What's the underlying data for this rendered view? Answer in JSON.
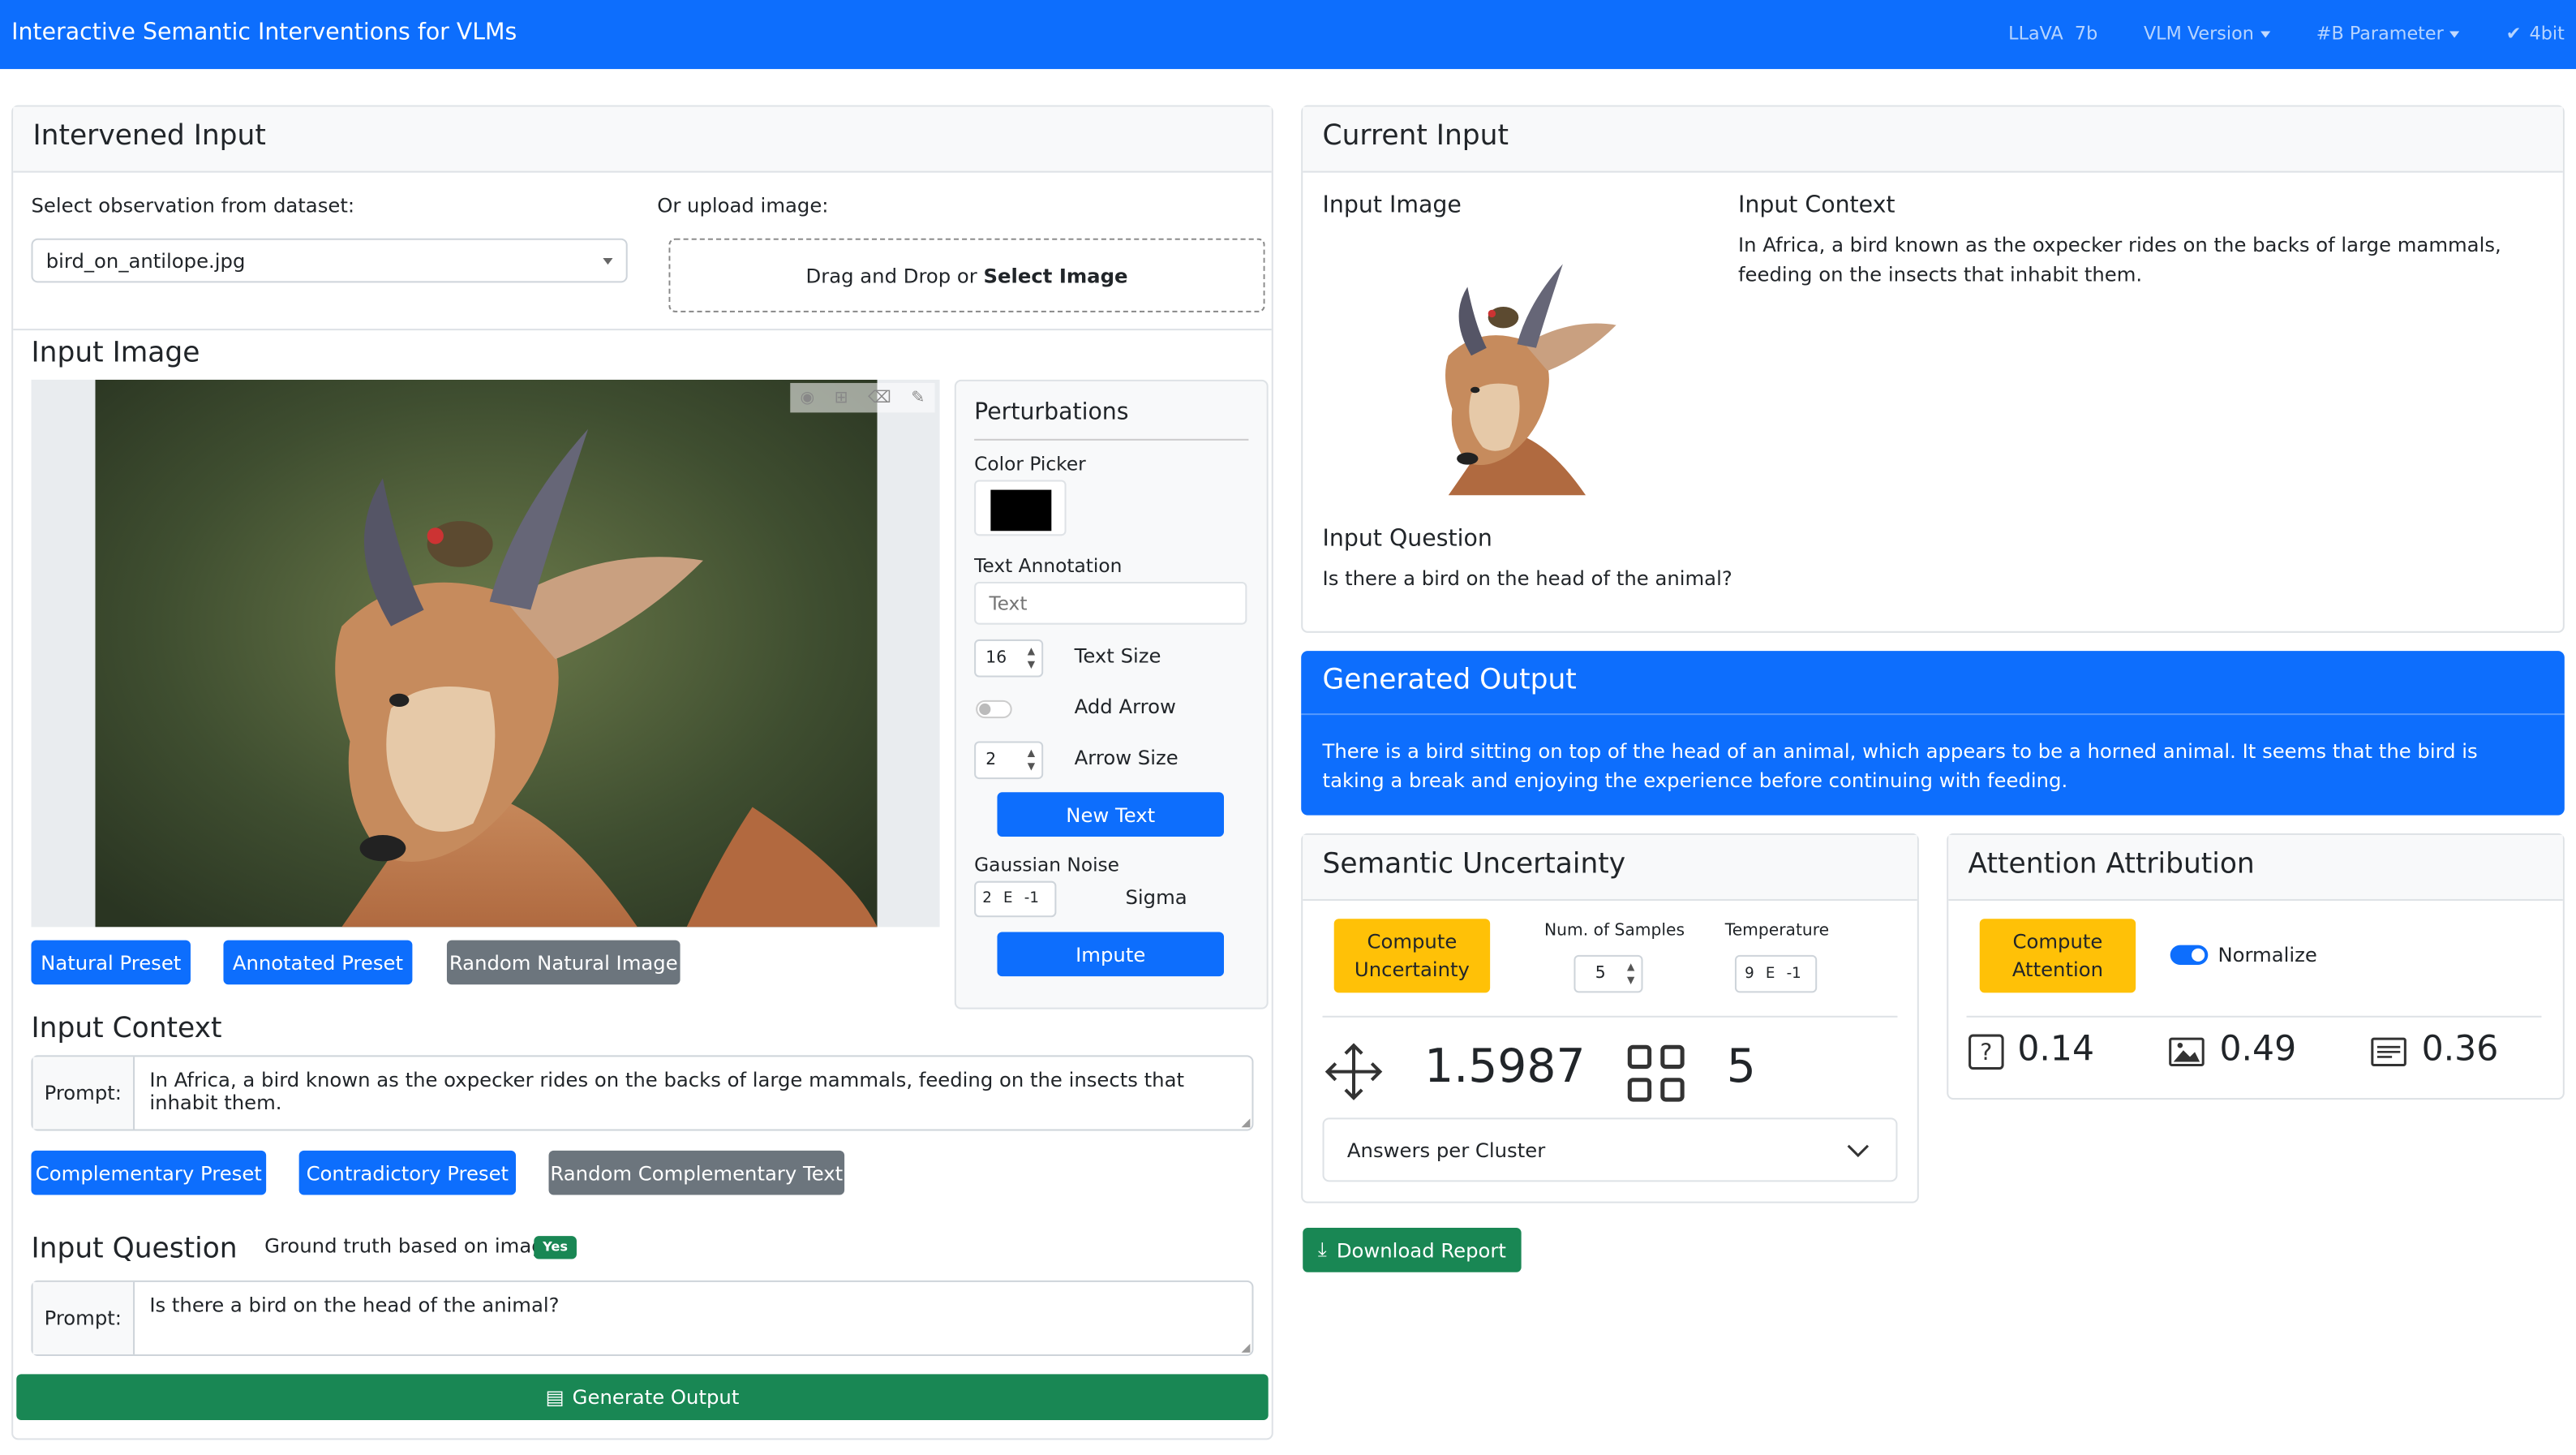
{
  "app_title": "Interactive Semantic Interventions for VLMs",
  "nav": {
    "model": "LLaVA",
    "size": "7b",
    "vlm_version": "VLM Version",
    "param": "#B Parameter",
    "quant": "4bit"
  },
  "intervened": {
    "title": "Intervened Input",
    "select_label": "Select observation from dataset:",
    "select_value": "bird_on_antilope.jpg",
    "upload_label": "Or upload image:",
    "drop_text": "Drag and Drop or ",
    "drop_link": "Select Image",
    "image_title": "Input Image",
    "perturb": {
      "title": "Perturbations",
      "color_label": "Color Picker",
      "color": "#000000",
      "text_label": "Text Annotation",
      "text_placeholder": "Text",
      "text_size": "16",
      "text_size_label": "Text Size",
      "add_arrow_label": "Add Arrow",
      "arrow_size": "2",
      "arrow_size_label": "Arrow Size",
      "new_text": "New Text",
      "noise_label": "Gaussian Noise",
      "sigma_mant": "2",
      "sigma_e": "E",
      "sigma_exp": "-1",
      "sigma_label": "Sigma",
      "impute": "Impute"
    },
    "presets": [
      "Natural Preset",
      "Annotated Preset",
      "Random Natural Image"
    ],
    "context_title": "Input Context",
    "prompt_label": "Prompt:",
    "context_text": "In Africa, a bird known as the oxpecker rides on the backs of large mammals, feeding on the insects that inhabit them.",
    "ctx_presets": [
      "Complementary Preset",
      "Contradictory Preset",
      "Random Complementary Text"
    ],
    "question_title": "Input Question",
    "ground_truth_label": "Ground truth based on image:",
    "ground_truth": "Yes",
    "question_text": "Is there a bird on the head of the animal?",
    "generate": "Generate Output"
  },
  "current": {
    "title": "Current Input",
    "image_title": "Input Image",
    "context_title": "Input Context",
    "context_text": "In Africa, a bird known as the oxpecker rides on the backs of large mammals, feeding on the insects that inhabit them.",
    "question_title": "Input Question",
    "question_text": "Is there a bird on the head of the animal?"
  },
  "output": {
    "title": "Generated Output",
    "text": "There is a bird sitting on top of the head of an animal, which appears to be a horned animal. It seems that the bird is taking a break and enjoying the experience before continuing with feeding."
  },
  "uncertainty": {
    "title": "Semantic Uncertainty",
    "button_l1": "Compute",
    "button_l2": "Uncertainty",
    "samples_label": "Num. of Samples",
    "samples": "5",
    "temp_label": "Temperature",
    "temp_mant": "9",
    "temp_e": "E",
    "temp_exp": "-1",
    "value": "1.5987",
    "clusters": "5",
    "accordion": "Answers per Cluster"
  },
  "attention": {
    "title": "Attention Attribution",
    "button_l1": "Compute",
    "button_l2": "Attention",
    "normalize": "Normalize",
    "question": "0.14",
    "image": "0.49",
    "text": "0.36"
  },
  "download": "Download Report"
}
